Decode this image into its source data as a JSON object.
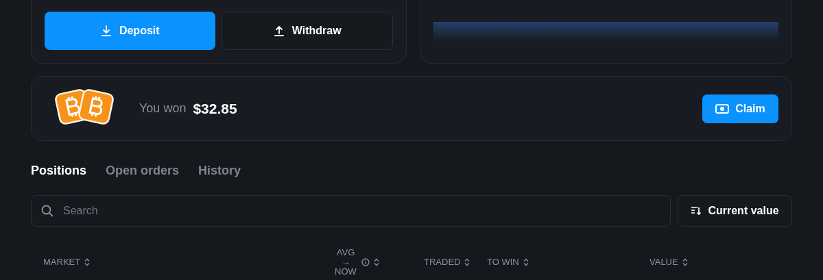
{
  "wallet_actions": [
    {
      "kind": "deposit",
      "label": "Deposit"
    },
    {
      "kind": "withdraw",
      "label": "Withdraw"
    }
  ],
  "win_banner": {
    "label": "You won",
    "amount": "$32.85",
    "button": "Claim"
  },
  "tabs": [
    {
      "label": "Positions",
      "selected": true
    },
    {
      "label": "Open orders",
      "selected": false
    },
    {
      "label": "History",
      "selected": false
    }
  ],
  "search": {
    "placeholder": "Search"
  },
  "sort_button": "Current value",
  "table": {
    "columns": [
      {
        "label": "MARKET",
        "info": false
      },
      {
        "label": "AVG → NOW",
        "info": true
      },
      {
        "label": "TRADED",
        "info": false
      },
      {
        "label": "TO WIN",
        "info": false
      },
      {
        "label": "VALUE",
        "info": false
      }
    ]
  }
}
